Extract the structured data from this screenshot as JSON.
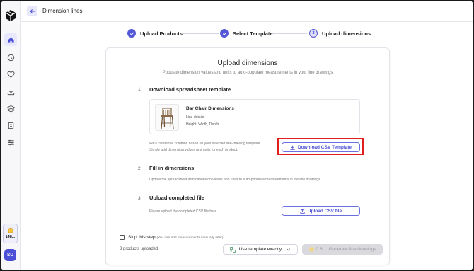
{
  "app": {
    "page_title": "Dimension lines"
  },
  "sidebar": {
    "icons": [
      "home-icon",
      "clock-icon",
      "heart-icon",
      "download-icon",
      "layers-icon",
      "file-icon",
      "settings-icon"
    ],
    "credits": "148...",
    "avatar": "SU"
  },
  "stepper": {
    "steps": [
      {
        "label": "Upload Products",
        "state": "done"
      },
      {
        "label": "Select Template",
        "state": "done"
      },
      {
        "label": "Upload dimensions",
        "state": "current",
        "number": "3"
      }
    ]
  },
  "card": {
    "title": "Upload dimensions",
    "subtitle": "Populate dimension values and units to auto-populate measurements in your line drawings",
    "sections": [
      {
        "number": "1",
        "title": "Download spreadsheet template"
      },
      {
        "number": "2",
        "title": "Fill in dimensions"
      },
      {
        "number": "3",
        "title": "Upload completed file"
      }
    ],
    "product": {
      "name": "Bar Chair Dimensions",
      "sub1": "Line details",
      "sub2": "Height, Width, Depth"
    },
    "download_note_line1": "We'll create the columns based on your selected line-drawing template.",
    "download_note_line2": "Simply add dimension values and units for each product.",
    "download_button": "Download CSV Template",
    "fill_note": "Update the spreadsheet with dimension values and units to auto-populate measurements in the line drawings",
    "upload_note": "Please upload the completed CSV file here",
    "upload_button": "Upload CSV file"
  },
  "footer": {
    "skip_label": "Skip this step",
    "skip_note": "(You can add measurements manually later)",
    "uploaded": "3 products uploaded",
    "template_button": "Use template exactly",
    "cost": "0.6",
    "generate_button": "Generate line drawings"
  },
  "colors": {
    "accent": "#5458d6",
    "highlight": "#e01e1e"
  }
}
